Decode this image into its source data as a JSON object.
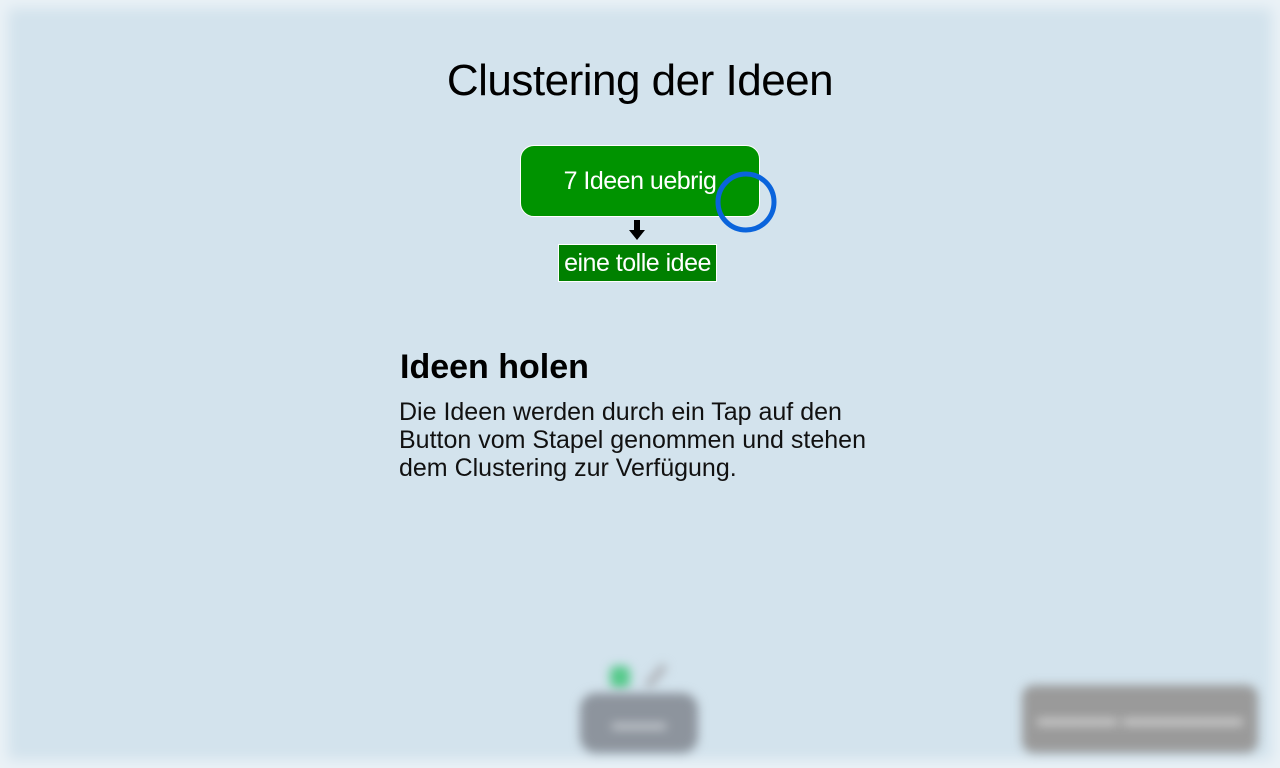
{
  "page": {
    "title": "Clustering der Ideen"
  },
  "stack_button": {
    "label": "7 Ideen uebrig"
  },
  "idea_card": {
    "label": "eine tolle idee"
  },
  "tutorial": {
    "heading": "Ideen holen",
    "text": "Die Ideen werden durch ein Tap auf den Button vom Stapel genommen und stehen dem Clustering zur Verfügung."
  },
  "colors": {
    "background": "#d3e3ed",
    "stack_green": "#009300",
    "card_green": "#008000",
    "touch_circle": "#0a64dc"
  },
  "icons": {
    "touch_indicator": "circle-outline",
    "arrow": "arrow-down"
  }
}
